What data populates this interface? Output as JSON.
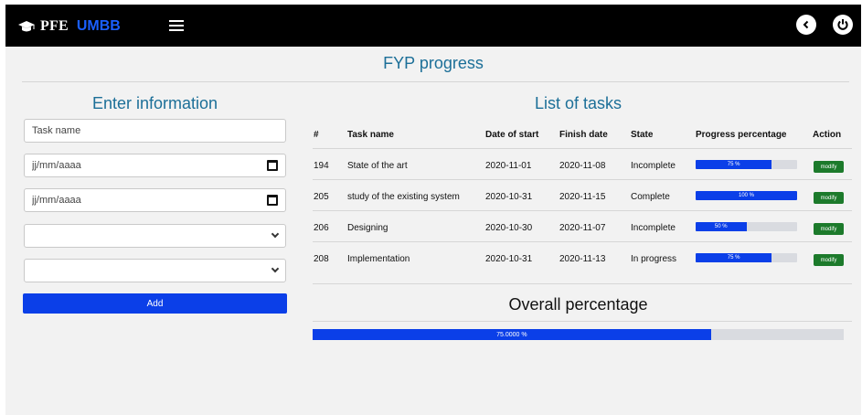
{
  "header": {
    "brand_icon": "graduation-cap-icon",
    "brand_prefix": "PFE",
    "brand_name": "UMBB",
    "menu_icon": "hamburger-icon",
    "back_icon": "back-arrow-icon",
    "power_icon": "power-icon"
  },
  "page": {
    "title": "FYP progress"
  },
  "form": {
    "title": "Enter information",
    "task_name_placeholder": "Task name",
    "start_date_placeholder": "jj/mm/aaaa",
    "finish_date_placeholder": "jj/mm/aaaa",
    "select1_value": "",
    "select2_value": "",
    "add_label": "Add"
  },
  "tasks": {
    "title": "List of tasks",
    "columns": [
      "#",
      "Task name",
      "Date of start",
      "Finish date",
      "State",
      "Progress percentage",
      "Action"
    ],
    "rows": [
      {
        "id": "194",
        "name": "State of the art",
        "start": "2020-11-01",
        "finish": "2020-11-08",
        "state": "Incomplete",
        "progress": 75,
        "progress_label": "75 %",
        "action": "modify"
      },
      {
        "id": "205",
        "name": "study of the existing system",
        "start": "2020-10-31",
        "finish": "2020-11-15",
        "state": "Complete",
        "progress": 100,
        "progress_label": "100 %",
        "action": "modify"
      },
      {
        "id": "206",
        "name": "Designing",
        "start": "2020-10-30",
        "finish": "2020-11-07",
        "state": "Incomplete",
        "progress": 50,
        "progress_label": "50 %",
        "action": "modify"
      },
      {
        "id": "208",
        "name": "Implementation",
        "start": "2020-10-31",
        "finish": "2020-11-13",
        "state": "In progress",
        "progress": 75,
        "progress_label": "75 %",
        "action": "modify"
      }
    ]
  },
  "overall": {
    "title": "Overall percentage",
    "progress": 75,
    "progress_label": "75.0000 %"
  },
  "colors": {
    "topbar": "#000000",
    "brand_accent": "#1a5fff",
    "title_teal": "#1c6f98",
    "primary_blue": "#0b3fe8",
    "modify_green": "#1c7a2b",
    "background": "#f2f2f2"
  }
}
